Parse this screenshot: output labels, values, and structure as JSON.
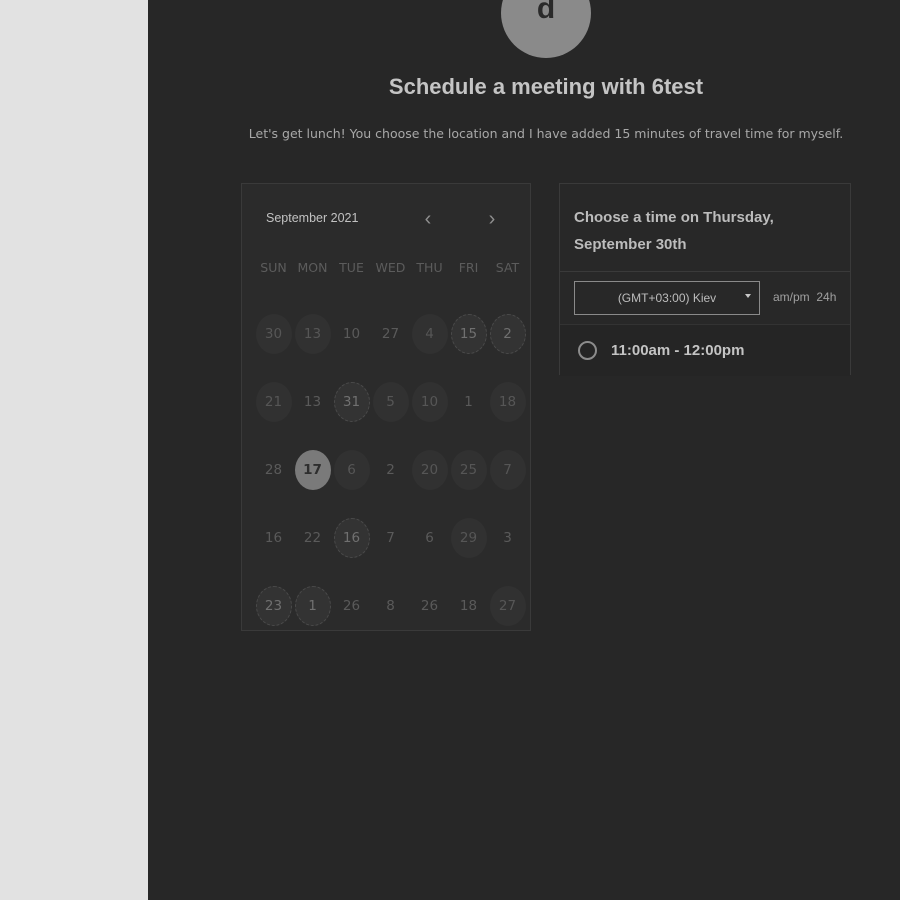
{
  "header": {
    "avatar_letter": "d",
    "title": "Schedule a meeting with 6test",
    "description": "Let's get lunch! You choose the location and I have added 15 minutes of travel time for myself."
  },
  "calendar": {
    "month": "September 2021",
    "prev_icon": "chevron-left-icon",
    "next_icon": "chevron-right-icon",
    "prev_glyph": "‹",
    "next_glyph": "›",
    "weekdays": [
      "SUN",
      "MON",
      "TUE",
      "WED",
      "THU",
      "FRI",
      "SAT"
    ],
    "days": [
      {
        "label": "30",
        "state": "avail"
      },
      {
        "label": "13",
        "state": "avail"
      },
      {
        "label": "10",
        "state": "plain"
      },
      {
        "label": "27",
        "state": "plain"
      },
      {
        "label": "4",
        "state": "avail"
      },
      {
        "label": "15",
        "state": "hatch"
      },
      {
        "label": "2",
        "state": "hatch"
      },
      {
        "label": "21",
        "state": "avail"
      },
      {
        "label": "13",
        "state": "plain"
      },
      {
        "label": "31",
        "state": "hatch"
      },
      {
        "label": "5",
        "state": "avail"
      },
      {
        "label": "10",
        "state": "avail"
      },
      {
        "label": "1",
        "state": "plain"
      },
      {
        "label": "18",
        "state": "avail"
      },
      {
        "label": "28",
        "state": "plain"
      },
      {
        "label": "17",
        "state": "selected"
      },
      {
        "label": "6",
        "state": "avail"
      },
      {
        "label": "2",
        "state": "plain"
      },
      {
        "label": "20",
        "state": "avail"
      },
      {
        "label": "25",
        "state": "avail"
      },
      {
        "label": "7",
        "state": "avail"
      },
      {
        "label": "16",
        "state": "plain"
      },
      {
        "label": "22",
        "state": "plain"
      },
      {
        "label": "16",
        "state": "hatch"
      },
      {
        "label": "7",
        "state": "plain"
      },
      {
        "label": "6",
        "state": "plain"
      },
      {
        "label": "29",
        "state": "avail"
      },
      {
        "label": "3",
        "state": "plain"
      },
      {
        "label": "23",
        "state": "hatch"
      },
      {
        "label": "1",
        "state": "hatch"
      },
      {
        "label": "26",
        "state": "plain"
      },
      {
        "label": "8",
        "state": "plain"
      },
      {
        "label": "26",
        "state": "plain"
      },
      {
        "label": "18",
        "state": "plain"
      },
      {
        "label": "27",
        "state": "avail"
      }
    ]
  },
  "time_panel": {
    "heading_line1": "Choose a time on Thursday,",
    "heading_line2": "September 30th",
    "timezone": "(GMT+03:00) Kiev",
    "format_12h": "am/pm",
    "format_24h": "24h",
    "slots": [
      {
        "label": "11:00am - 12:00pm"
      }
    ]
  }
}
